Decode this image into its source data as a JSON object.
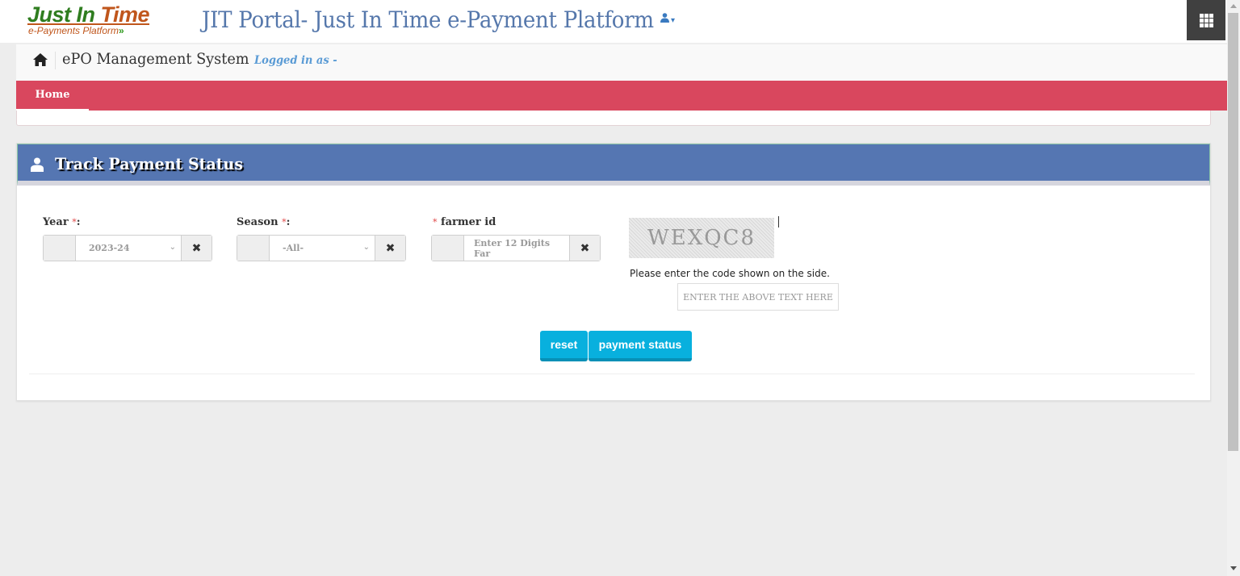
{
  "header": {
    "logo_line1_a": "Just In ",
    "logo_line1_b": "Time",
    "logo_line2": "e-Payments Platform",
    "logo_arrows": "»",
    "app_title": "JIT Portal- Just In Time e-Payment Platform",
    "user_menu_caret": "▾",
    "apps_icon": "grid-icon"
  },
  "subheader": {
    "system_title": "ePO Management System",
    "logged_in_label": "Logged in as -"
  },
  "nav": {
    "items": [
      {
        "label": "Home",
        "active": true
      }
    ]
  },
  "panel": {
    "title": "Track Payment Status",
    "fields": {
      "year": {
        "label": "Year",
        "required_mark": "*",
        "colon": ":",
        "value": "2023-24"
      },
      "season": {
        "label": "Season",
        "required_mark": "*",
        "colon": ":",
        "value": "-All-"
      },
      "farmer_id": {
        "label": "farmer id",
        "required_mark": "*",
        "placeholder": "Enter 12 Digits Far"
      }
    },
    "clear_symbol": "✖",
    "captcha": {
      "code": "WEXQC8",
      "hint": "Please enter the code shown on the side.",
      "placeholder": "ENTER THE ABOVE TEXT HERE"
    },
    "buttons": {
      "reset": "reset",
      "payment_status": "payment status"
    }
  },
  "colors": {
    "nav_bar": "#d9475e",
    "panel_header": "#5576b2",
    "button": "#08b0de",
    "title_text": "#5577ab"
  }
}
